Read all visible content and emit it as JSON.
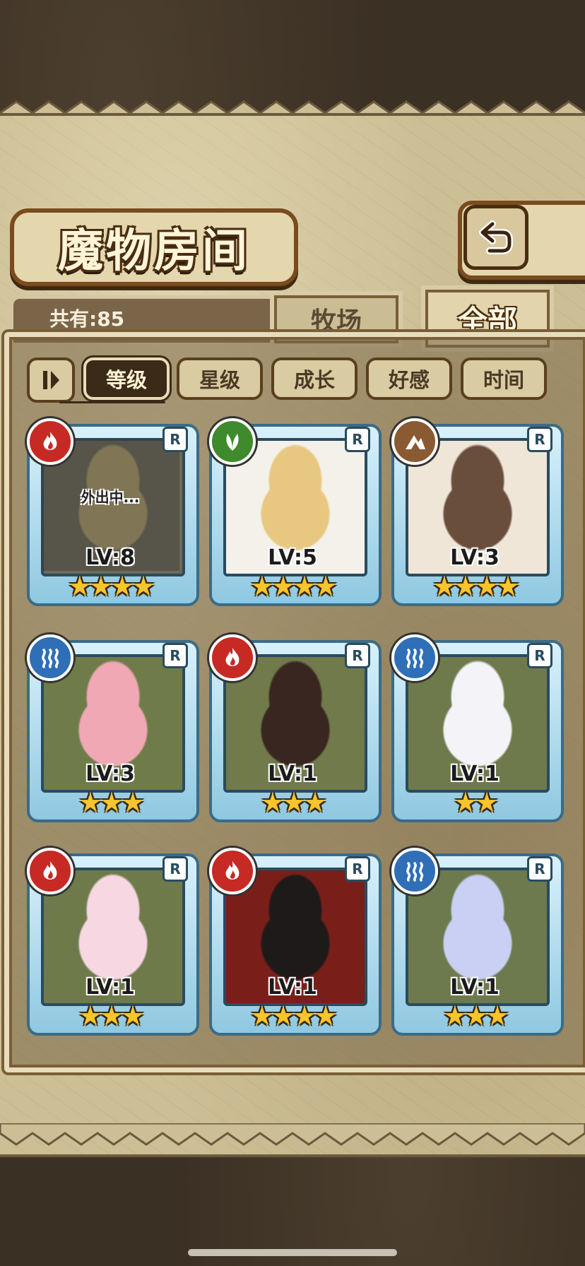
{
  "header": {
    "title": "魔物房间"
  },
  "summary": {
    "count_label": "共有:85"
  },
  "tabs": [
    {
      "label": "牧场",
      "active": false
    },
    {
      "label": "全部",
      "active": true
    }
  ],
  "sort": {
    "options": [
      {
        "label": "等级",
        "active": true
      },
      {
        "label": "星级",
        "active": false
      },
      {
        "label": "成长",
        "active": false
      },
      {
        "label": "好感",
        "active": false
      },
      {
        "label": "时间",
        "active": false
      }
    ]
  },
  "monsters": [
    {
      "element": "fire",
      "rank": "R",
      "level": "LV:8",
      "stars": 4,
      "status": "外出中...",
      "portrait_colors": [
        "#6e6a55",
        "#b8a46a"
      ]
    },
    {
      "element": "leaf",
      "rank": "R",
      "level": "LV:5",
      "stars": 4,
      "status": "",
      "portrait_colors": [
        "#f4f1ea",
        "#e8c880"
      ]
    },
    {
      "element": "earth",
      "rank": "R",
      "level": "LV:3",
      "stars": 4,
      "status": "",
      "portrait_colors": [
        "#efe6d8",
        "#6a4e3c"
      ]
    },
    {
      "element": "water",
      "rank": "R",
      "level": "LV:3",
      "stars": 3,
      "status": "",
      "portrait_colors": [
        "#6f7c49",
        "#f0a8b5"
      ]
    },
    {
      "element": "fire",
      "rank": "R",
      "level": "LV:1",
      "stars": 3,
      "status": "",
      "portrait_colors": [
        "#707a4a",
        "#3a2620"
      ]
    },
    {
      "element": "water",
      "rank": "R",
      "level": "LV:1",
      "stars": 2,
      "status": "",
      "portrait_colors": [
        "#6e7a4b",
        "#f3f3f8"
      ]
    },
    {
      "element": "fire",
      "rank": "R",
      "level": "LV:1",
      "stars": 3,
      "status": "",
      "portrait_colors": [
        "#6f7a4b",
        "#f6d7e2"
      ]
    },
    {
      "element": "fire",
      "rank": "R",
      "level": "LV:1",
      "stars": 4,
      "status": "",
      "portrait_colors": [
        "#7a1e1a",
        "#1f1a1a"
      ]
    },
    {
      "element": "water",
      "rank": "R",
      "level": "LV:1",
      "stars": 3,
      "status": "",
      "portrait_colors": [
        "#6c7a4e",
        "#c9d0f4"
      ]
    }
  ],
  "icons": {
    "back": "back-arrow-icon",
    "sort_order": "sort-order-icon",
    "fire": "fire-icon",
    "leaf": "leaf-icon",
    "earth": "earth-icon",
    "water": "water-icon",
    "star": "star-icon"
  },
  "colors": {
    "parchment": "#cdbf95",
    "frame": "#7a5e35",
    "card": "#8fc8e1",
    "star": "#f7c52c"
  }
}
